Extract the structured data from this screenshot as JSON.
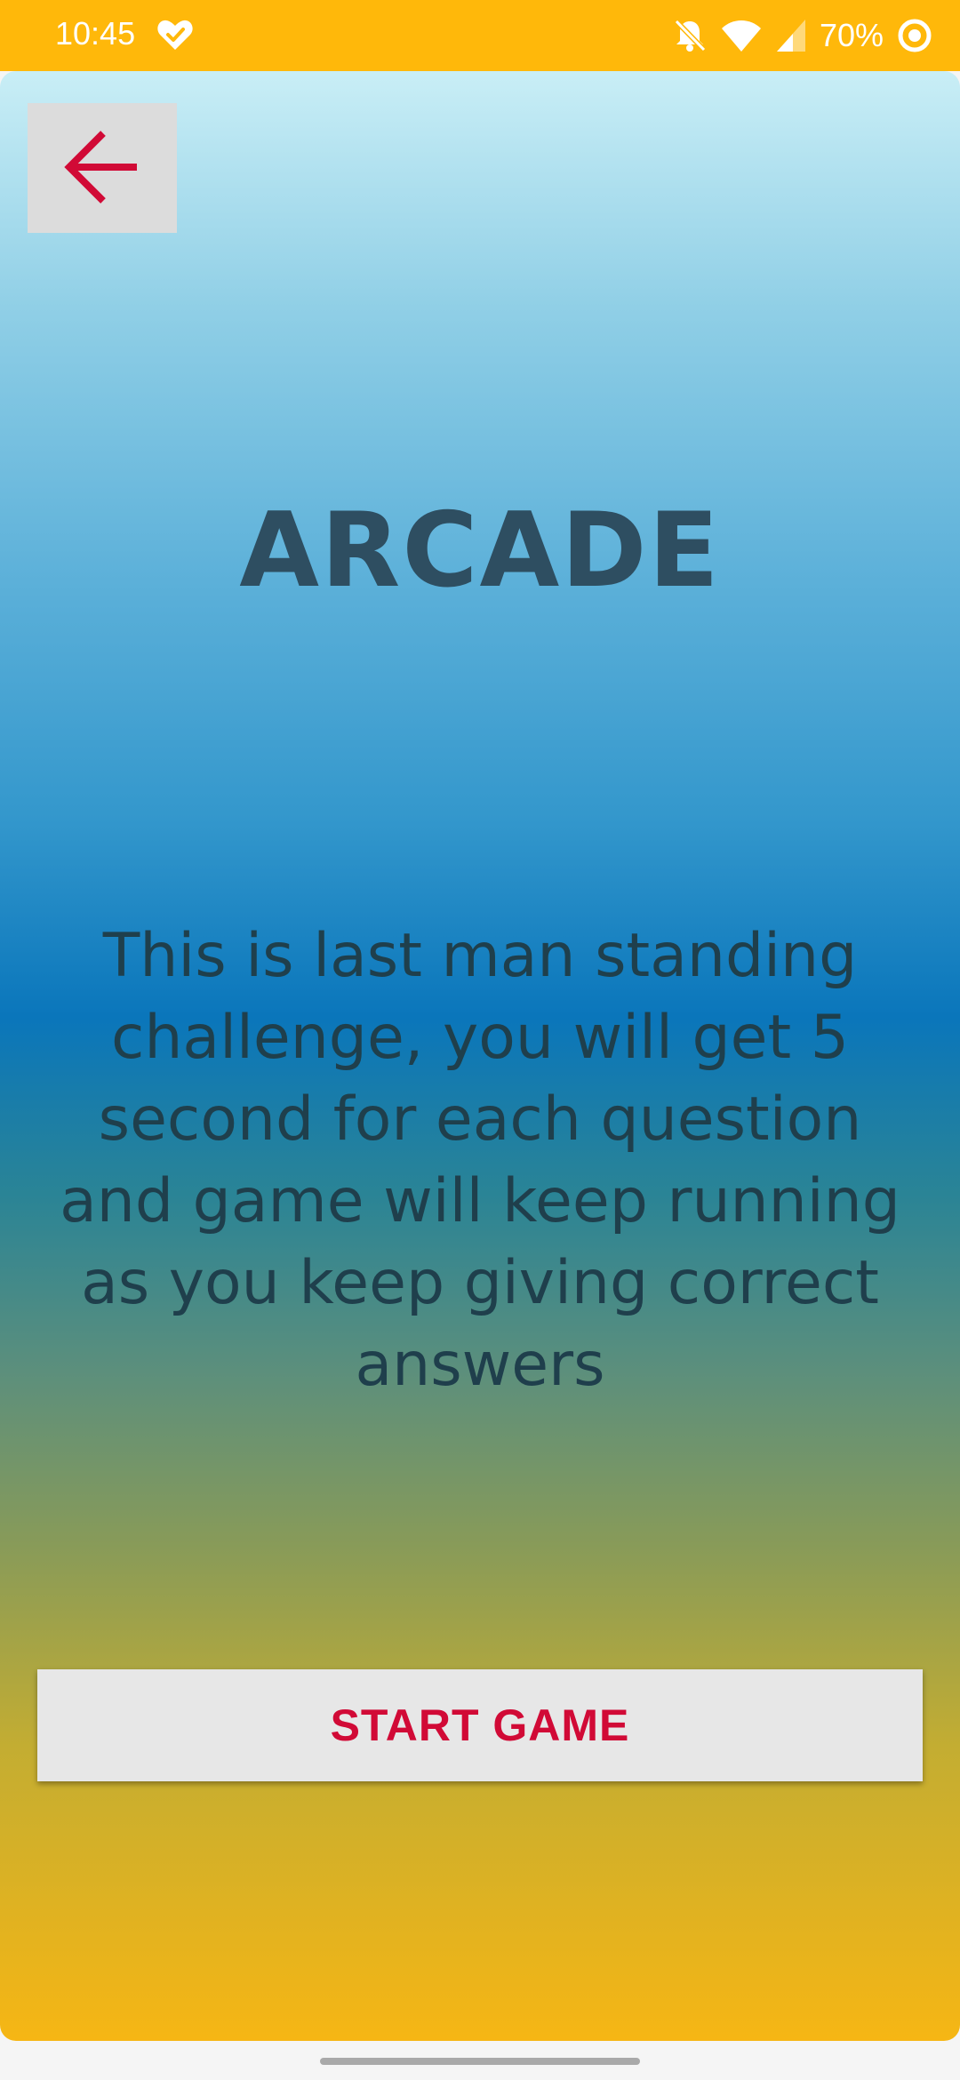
{
  "status_bar": {
    "time": "10:45",
    "battery_percent": "70%",
    "background_color": "#ffb80a",
    "icons": [
      "heart-check-icon",
      "bell-off-icon",
      "wifi-icon",
      "cell-signal-icon",
      "battery-saver-icon"
    ]
  },
  "screen": {
    "back_button_icon": "arrow-left-icon",
    "title": "ARCADE",
    "description": "This is last man standing challenge, you will get 5 second for each question and game will keep running as you keep giving correct answers",
    "start_button_label": "START GAME"
  },
  "colors": {
    "accent": "#d10a36",
    "title_text": "#2e4e61",
    "gradient_top": "#c9eef6",
    "gradient_mid": "#0a76bb",
    "gradient_bottom": "#f6b614"
  }
}
